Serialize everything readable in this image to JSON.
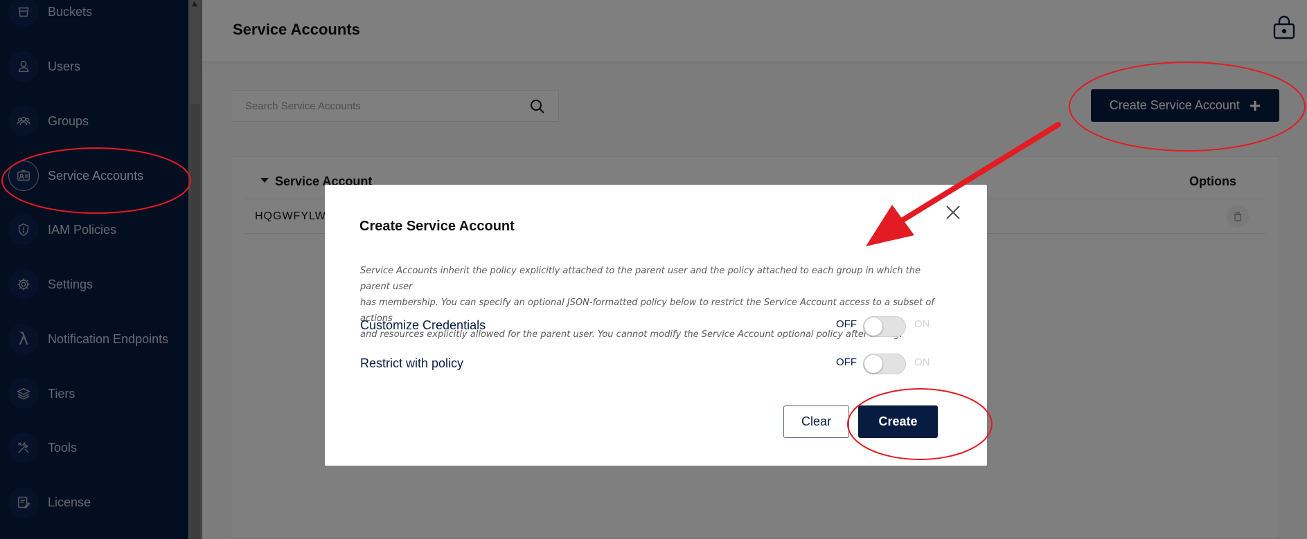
{
  "sidebar": {
    "items": [
      {
        "label": "Buckets",
        "icon": "bucket-icon"
      },
      {
        "label": "Users",
        "icon": "user-icon"
      },
      {
        "label": "Groups",
        "icon": "groups-icon"
      },
      {
        "label": "Service Accounts",
        "icon": "id-card-icon",
        "active": true
      },
      {
        "label": "IAM Policies",
        "icon": "shield-icon"
      },
      {
        "label": "Settings",
        "icon": "gear-icon"
      },
      {
        "label": "Notification Endpoints",
        "icon": "lambda-icon"
      },
      {
        "label": "Tiers",
        "icon": "layers-icon"
      },
      {
        "label": "Tools",
        "icon": "tools-icon"
      },
      {
        "label": "License",
        "icon": "license-icon"
      }
    ]
  },
  "header": {
    "title": "Service Accounts",
    "lock_icon": "lock-icon"
  },
  "toolbar": {
    "search_placeholder": "Search Service Accounts",
    "create_button_label": "Create Service Account"
  },
  "table": {
    "columns": [
      "Service Account",
      "Options"
    ],
    "rows": [
      {
        "service_account": "HQGWFYLWO"
      }
    ]
  },
  "modal": {
    "title": "Create Service Account",
    "description_lines": [
      "Service Accounts inherit the policy explicitly attached to the parent user and the policy attached to each group in which the parent user",
      "has membership. You can specify an optional JSON-formatted policy below to restrict the Service Account access to a subset of actions",
      "and resources explicitly allowed for the parent user. You cannot modify the Service Account optional policy after saving."
    ],
    "toggles": [
      {
        "label": "Customize Credentials",
        "off_label": "OFF",
        "on_label": "ON",
        "value": "OFF"
      },
      {
        "label": "Restrict with policy",
        "off_label": "OFF",
        "on_label": "ON",
        "value": "OFF"
      }
    ],
    "clear_label": "Clear",
    "create_label": "Create"
  },
  "colors": {
    "sidebar_bg": "#081c42",
    "primary": "#081c42",
    "annotation_red": "#e31b23"
  }
}
